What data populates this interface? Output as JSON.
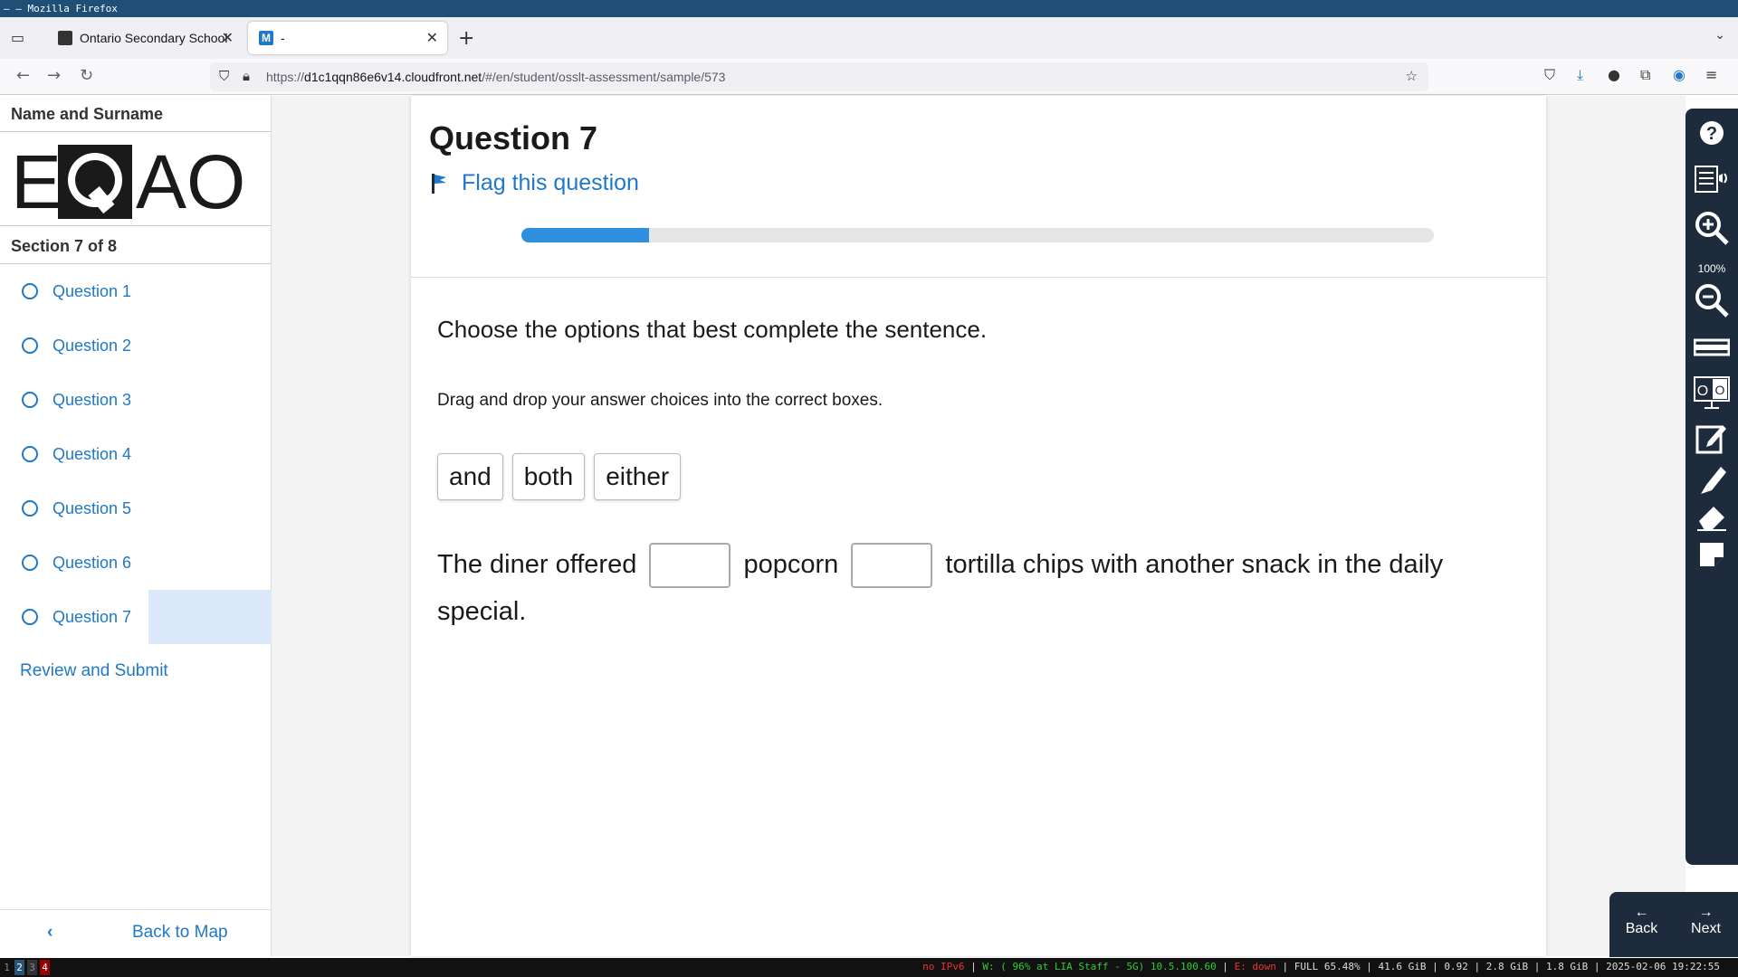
{
  "window": {
    "title": "– – Mozilla Firefox"
  },
  "tabs": [
    {
      "label": "Ontario Secondary School"
    },
    {
      "label": "-"
    }
  ],
  "url": {
    "prefix": "https://",
    "host": "d1c1qqn86e6v14.cloudfront.net",
    "path": "/#/en/student/osslt-assessment/sample/573"
  },
  "sidebar": {
    "name": "Name and Surname",
    "logo": "EQAO",
    "section": "Section 7 of 8",
    "questions": [
      "Question 1",
      "Question 2",
      "Question 3",
      "Question 4",
      "Question 5",
      "Question 6",
      "Question 7"
    ],
    "review": "Review and Submit",
    "back_map": "Back to Map"
  },
  "main": {
    "title": "Question 7",
    "flag": "Flag this question",
    "progress": 0.14,
    "prompt": "Choose the options that best complete the sentence.",
    "instruction": "Drag and drop your answer choices into the correct boxes.",
    "choices": [
      "and",
      "both",
      "either"
    ],
    "sentence": {
      "part1": "The diner offered",
      "part2": "popcorn",
      "part3": "tortilla chips with another snack in the daily special."
    }
  },
  "tools": {
    "zoom": "100%",
    "back": "Back",
    "next": "Next"
  },
  "statusbar": {
    "workspaces": [
      "1",
      "2",
      "3",
      "4"
    ],
    "text_red": "no IPv6",
    "text_green": "W: ( 96% at LIA Staff - 5G) 10.5.100.60",
    "text_red2": "E: down",
    "text_rest": "FULL 65.48% | 41.6 GiB | 0.92 | 2.8 GiB | 1.8 GiB | 2025-02-06 19:22:55"
  }
}
